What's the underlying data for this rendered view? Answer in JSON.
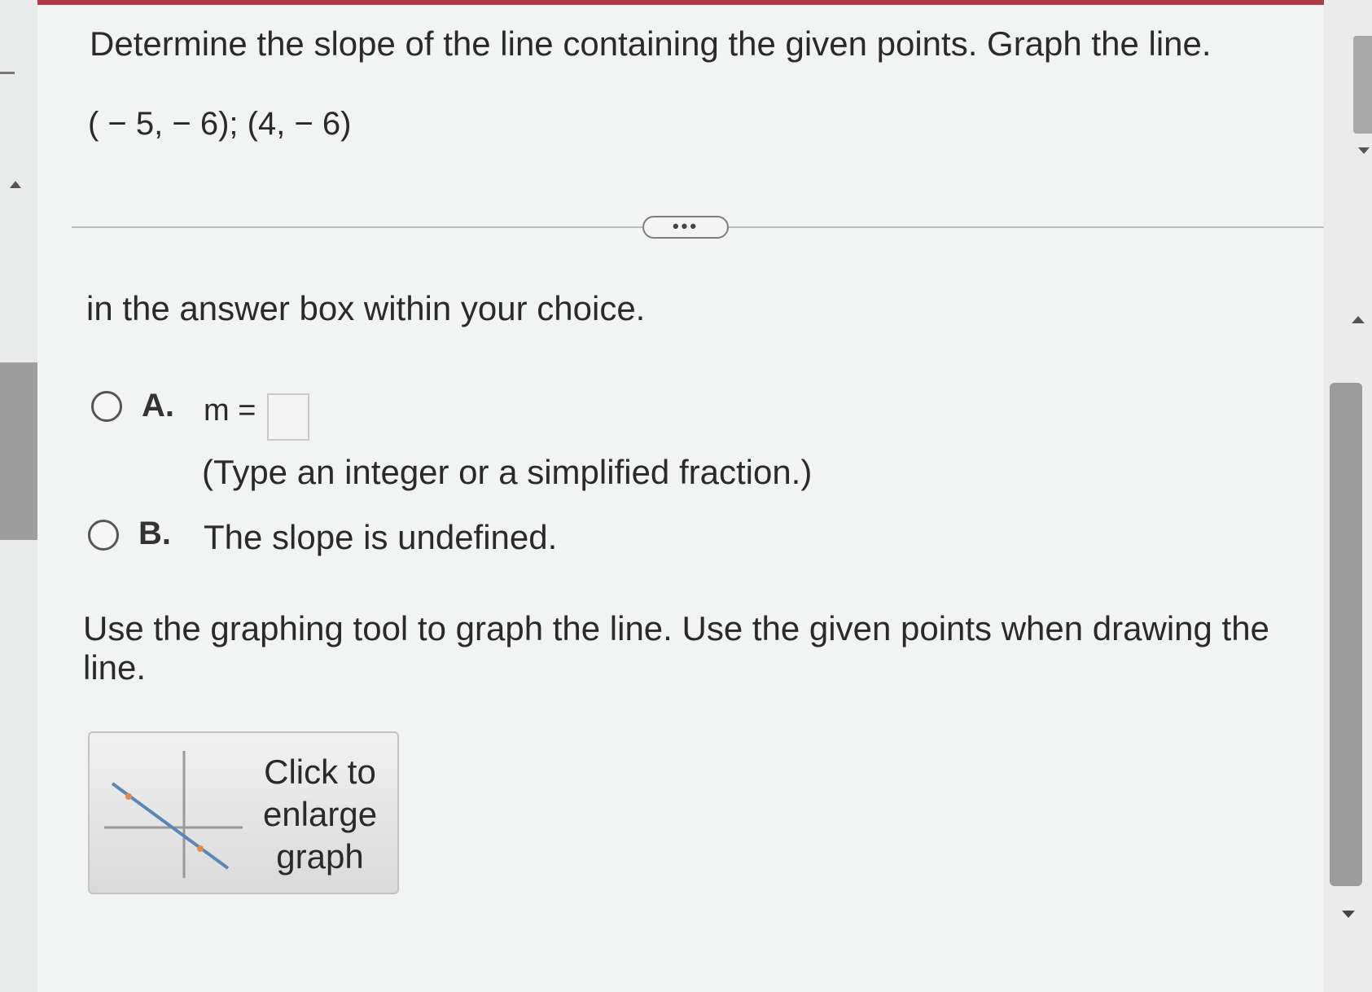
{
  "question": {
    "prompt": "Determine the slope of the line containing the given points. Graph the line.",
    "points": "( − 5, − 6); (4, − 6)"
  },
  "toolbar": {
    "expand_label": "•••"
  },
  "instruction": "in the answer box within your choice.",
  "options": {
    "a": {
      "letter": "A.",
      "prefix": "m =",
      "value": "",
      "hint": "(Type an integer or a simplified fraction.)"
    },
    "b": {
      "letter": "B.",
      "text": "The slope is undefined."
    }
  },
  "graph": {
    "instruction": "Use the graphing tool to graph the line.  Use the given points when drawing the line.",
    "button_label": "Click to\nenlarge\ngraph"
  },
  "colors": {
    "accent_bar": "#b03b45",
    "point_marker": "#e8894a",
    "line": "#5b87b8"
  }
}
